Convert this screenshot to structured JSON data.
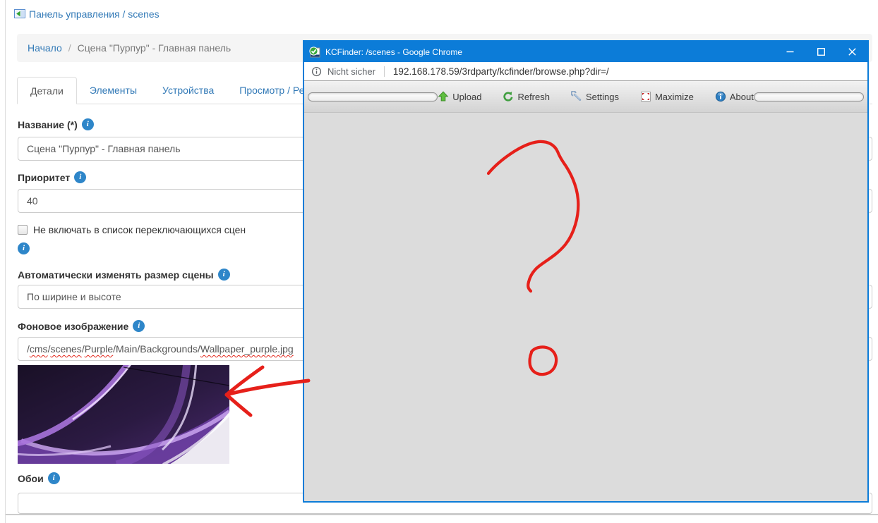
{
  "page": {
    "top_link": {
      "label": "Панель управления / scenes"
    },
    "breadcrumb": {
      "home": "Начало",
      "separator": "/",
      "current": "Сцена \"Пурпур\" - Главная панель"
    },
    "tabs": [
      {
        "label": "Детали",
        "active": true
      },
      {
        "label": "Элементы",
        "active": false
      },
      {
        "label": "Устройства",
        "active": false
      },
      {
        "label": "Просмотр / Ред",
        "active": false
      }
    ],
    "fields": {
      "name": {
        "label": "Название (*)",
        "value": "Сцена \"Пурпур\" - Главная панель"
      },
      "priority": {
        "label": "Приоритет",
        "value": "40"
      },
      "exclude_from_switch": {
        "label": "Не включать в список переключающихся сцен",
        "checked": false
      },
      "auto_resize": {
        "label": "Автоматически изменять размер сцены",
        "value": "По ширине и высоте"
      },
      "background_image": {
        "label": "Фоновое изображение",
        "value": "/cms/scenes/Purple/Main/Backgrounds/Wallpaper_purple.jpg",
        "path_segments": [
          {
            "text": "/",
            "misspelled": false
          },
          {
            "text": "cms",
            "misspelled": true
          },
          {
            "text": "/",
            "misspelled": false
          },
          {
            "text": "scenes",
            "misspelled": true
          },
          {
            "text": "/",
            "misspelled": false
          },
          {
            "text": "Purple",
            "misspelled": true
          },
          {
            "text": "/Main/Backgrounds/",
            "misspelled": false
          },
          {
            "text": "Wallpaper_purple.jpg",
            "misspelled": true
          }
        ]
      },
      "wallpaper": {
        "label": "Обои",
        "value": ""
      }
    }
  },
  "kcfinder": {
    "window_title": "KCFinder: /scenes - Google Chrome",
    "address_bar": {
      "security_label": "Nicht sicher",
      "url": "192.168.178.59/3rdparty/kcfinder/browse.php?dir=/"
    },
    "toolbar": [
      {
        "icon": "upload-icon",
        "label": "Upload"
      },
      {
        "icon": "refresh-icon",
        "label": "Refresh"
      },
      {
        "icon": "settings-icon",
        "label": "Settings"
      },
      {
        "icon": "maximize-icon",
        "label": "Maximize"
      },
      {
        "icon": "about-icon",
        "label": "About"
      }
    ]
  },
  "annotations": {
    "color": "#e6201a",
    "items": [
      "question-mark-scribble",
      "question-mark-dot",
      "arrow-to-wallpaper-thumbnail"
    ]
  },
  "colors": {
    "titlebar_blue": "#0c7cd8",
    "link_blue": "#337ab7",
    "info_icon_blue": "#2e86c9",
    "kcfinder_bg": "#dcdcdc",
    "annotation_red": "#e6201a"
  }
}
